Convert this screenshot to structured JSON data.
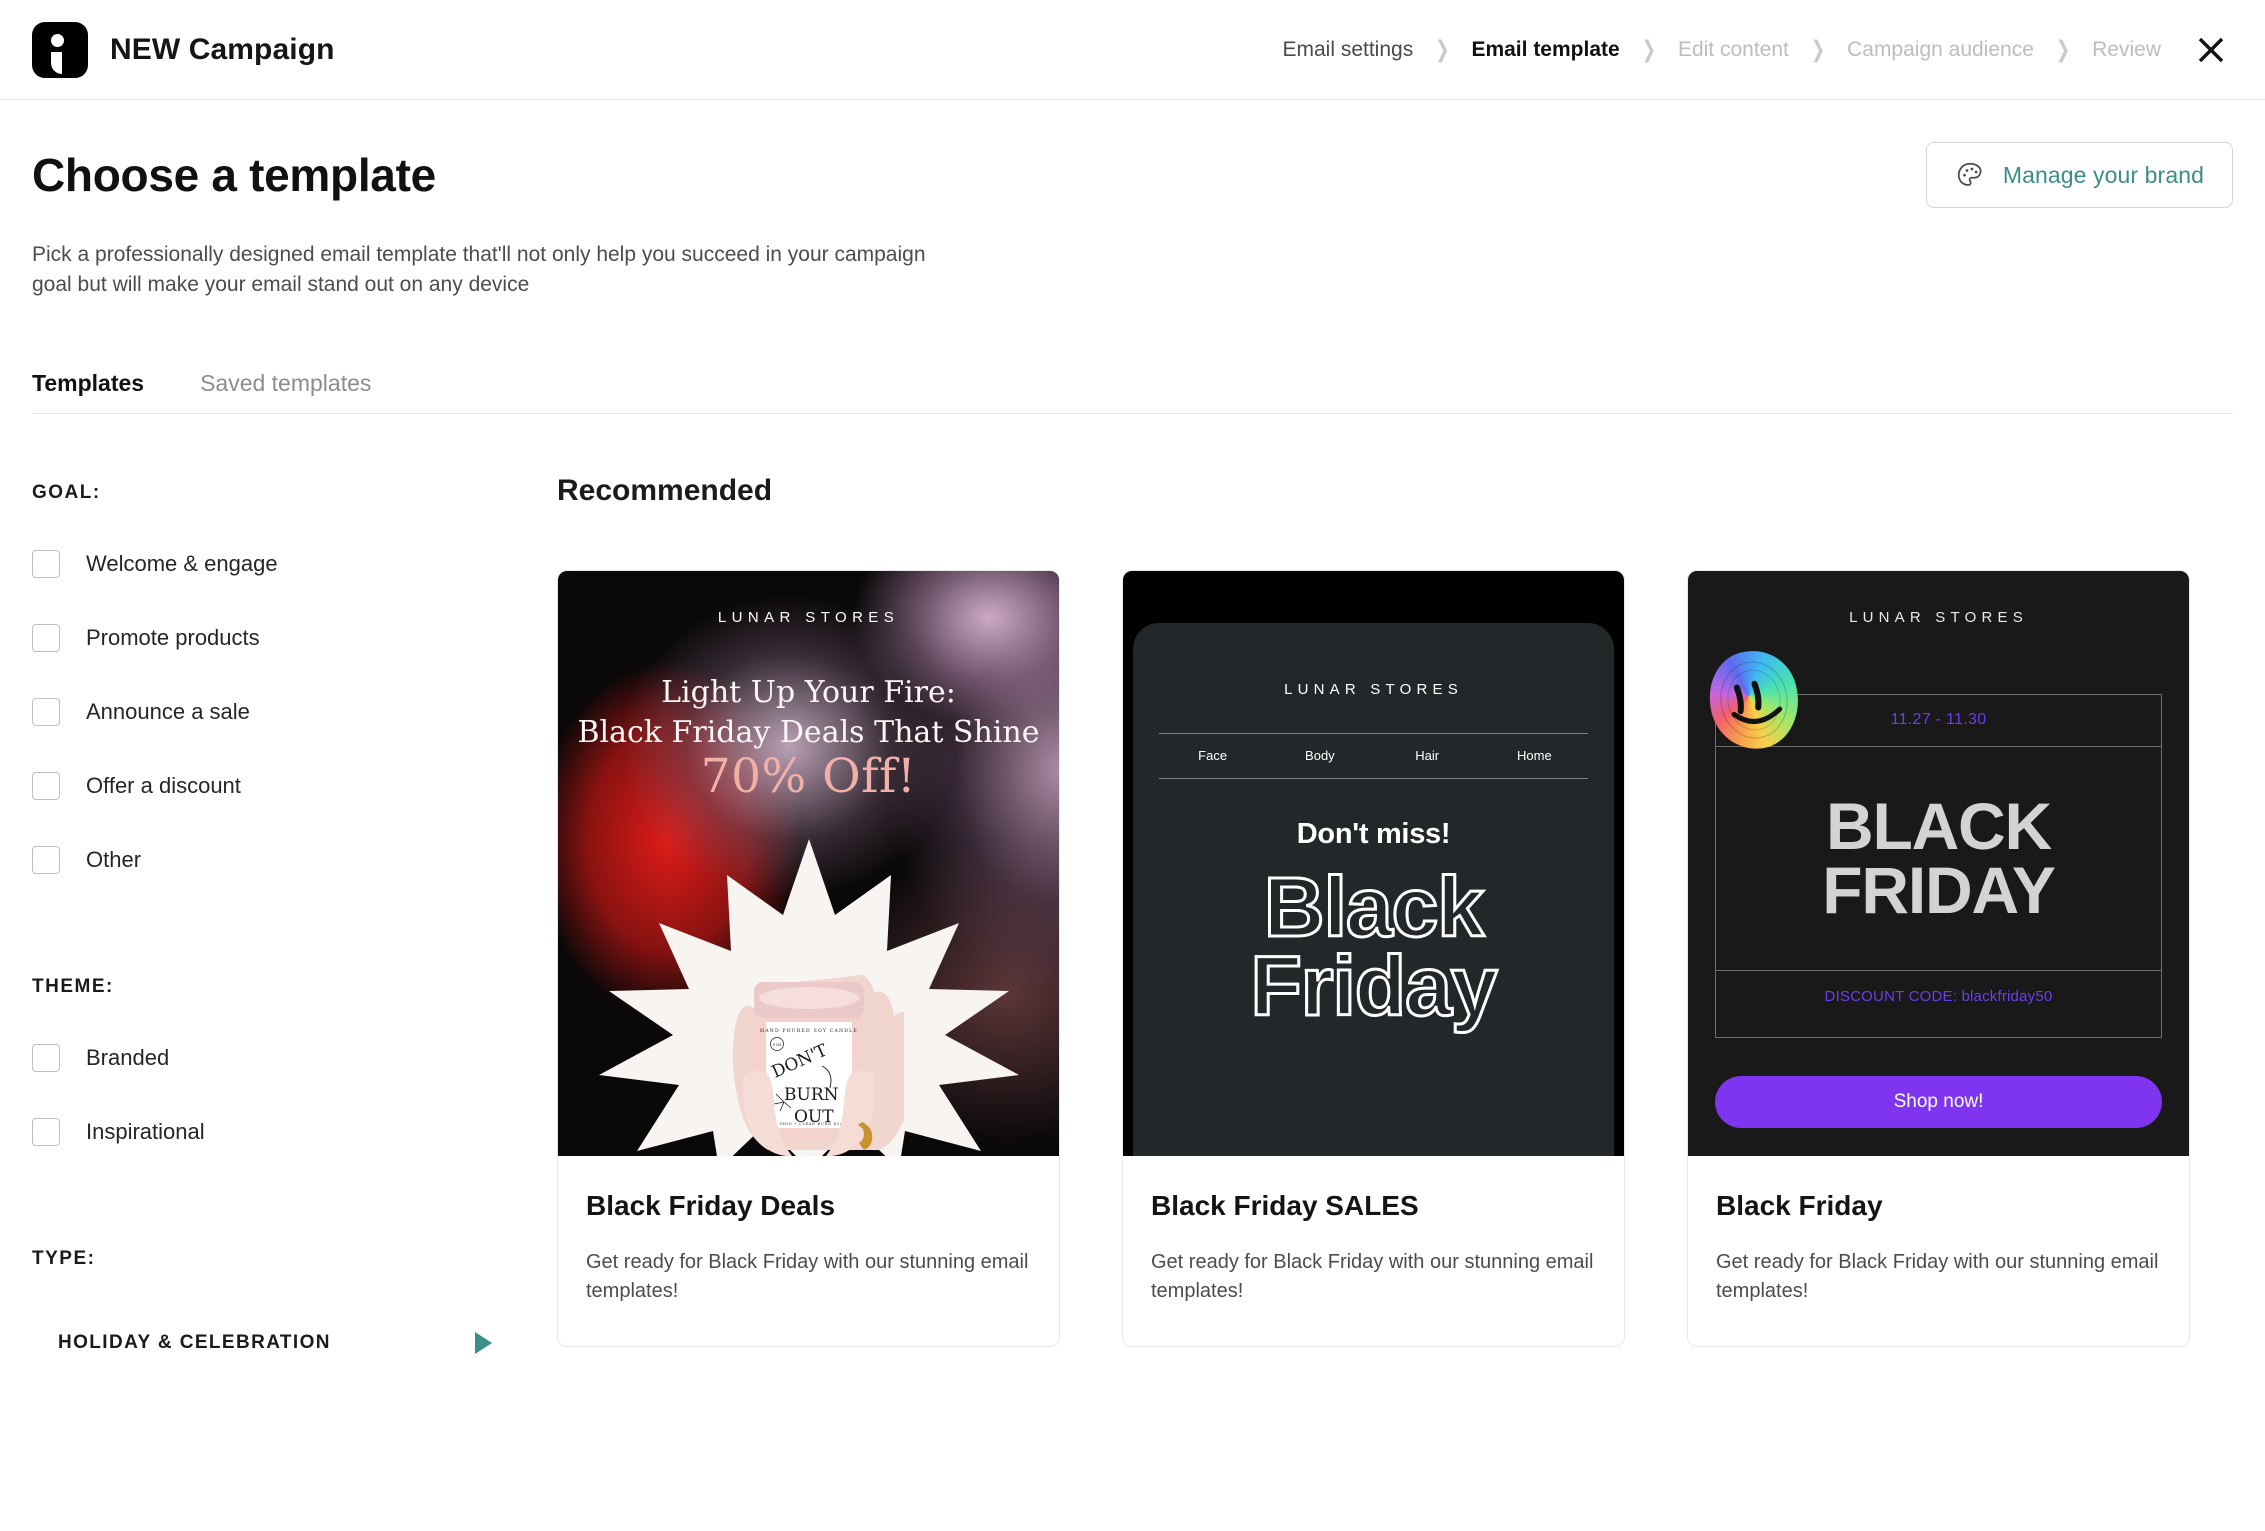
{
  "topbar": {
    "logo_name": "brand-logo-icon",
    "title": "NEW Campaign",
    "breadcrumb": [
      {
        "label": "Email settings",
        "state": "done"
      },
      {
        "label": "Email template",
        "state": "active"
      },
      {
        "label": "Edit content",
        "state": "todo"
      },
      {
        "label": "Campaign audience",
        "state": "todo"
      },
      {
        "label": "Review",
        "state": "todo"
      }
    ],
    "separator": "❯",
    "close_label": "✕"
  },
  "page": {
    "title": "Choose a template",
    "description": "Pick a professionally designed email template that'll not only help you succeed in your campaign goal but will make your email stand out on any device",
    "brand_button": {
      "label": "Manage your brand",
      "icon": "palette-icon",
      "color": "#3b8e87"
    }
  },
  "tabs": [
    {
      "label": "Templates",
      "active": true
    },
    {
      "label": "Saved templates",
      "active": false
    }
  ],
  "sidebar": {
    "goal": {
      "label": "GOAL:",
      "options": [
        {
          "label": "Welcome & engage",
          "checked": false
        },
        {
          "label": "Promote products",
          "checked": false
        },
        {
          "label": "Announce a sale",
          "checked": false
        },
        {
          "label": "Offer a discount",
          "checked": false
        },
        {
          "label": "Other",
          "checked": false
        }
      ]
    },
    "theme": {
      "label": "THEME:",
      "options": [
        {
          "label": "Branded",
          "checked": false
        },
        {
          "label": "Inspirational",
          "checked": false
        }
      ]
    },
    "type": {
      "label": "TYPE:",
      "items": [
        {
          "label": "HOLIDAY & CELEBRATION",
          "expanded": false,
          "arrow_color": "#38908a"
        }
      ]
    }
  },
  "main": {
    "section_title": "Recommended",
    "cards": [
      {
        "title": "Black Friday Deals",
        "description": "Get ready for Black Friday with our stunning email templates!",
        "preview": {
          "store": "LUNAR STORES",
          "headline_line1": "Light Up Your Fire:",
          "headline_line2": "Black Friday Deals That Shine",
          "offer": "70% Off!",
          "product_label_line1": "DON'T",
          "product_label_line2": "BURN",
          "product_label_line3": "OUT"
        }
      },
      {
        "title": "Black Friday SALES",
        "description": "Get ready for Black Friday with our stunning email templates!",
        "preview": {
          "store": "LUNAR STORES",
          "nav": [
            "Face",
            "Body",
            "Hair",
            "Home"
          ],
          "kicker": "Don't miss!",
          "big_line1": "Black",
          "big_line2": "Friday"
        }
      },
      {
        "title": "Black Friday",
        "description": "Get ready for Black Friday with our stunning email templates!",
        "preview": {
          "store": "LUNAR STORES",
          "dates": "11.27 - 11.30",
          "big_line1": "BLACK",
          "big_line2": "FRIDAY",
          "discount": "DISCOUNT CODE: blackfriday50",
          "cta": "Shop now!",
          "cta_color": "#7f34f0",
          "accent_color": "#6d3df0"
        }
      }
    ]
  }
}
